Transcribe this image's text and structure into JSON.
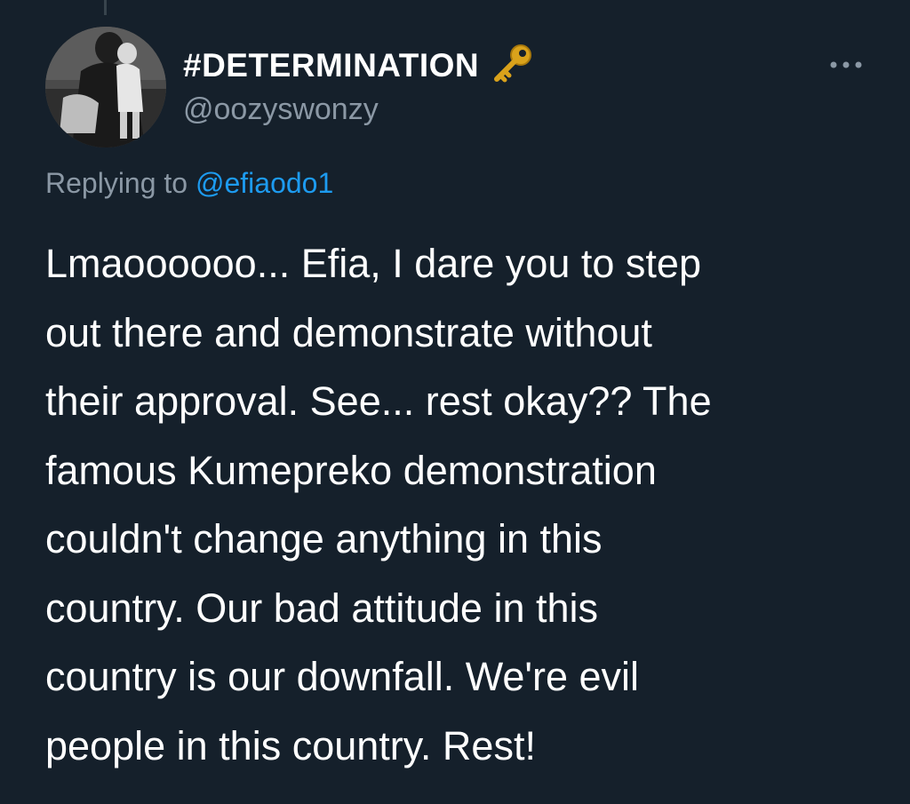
{
  "theme": {
    "background": "#15202b",
    "text_primary": "#ffffff",
    "text_secondary": "#8b98a5",
    "link": "#1d9bf0",
    "thread_line": "#38444d"
  },
  "tweet": {
    "author": {
      "display_name": "#DETERMINATION",
      "emoji_icon": "key-icon",
      "handle": "@oozyswonzy",
      "avatar_icon": "avatar"
    },
    "more_icon": "more-dots-icon",
    "replying": {
      "prefix": "Replying to ",
      "mention": "@efiaodo1"
    },
    "text_lines": [
      "Lmaoooooo... Efia, I dare you to step",
      "out there and demonstrate without",
      "their approval. See... rest okay?? The",
      "famous Kumepreko demonstration",
      "couldn't change anything in this",
      "country. Our bad attitude in this",
      "country is our downfall. We're evil",
      "people in this country. Rest!"
    ]
  }
}
